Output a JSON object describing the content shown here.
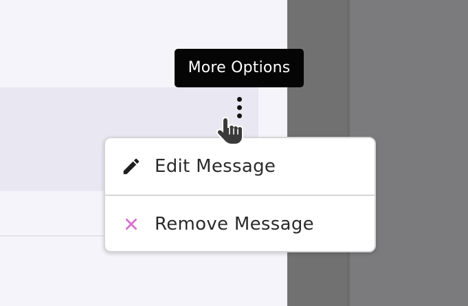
{
  "tooltip": {
    "text": "More Options"
  },
  "menu": {
    "items": [
      {
        "label": "Edit Message",
        "icon": "pencil-icon"
      },
      {
        "label": "Remove Message",
        "icon": "close-icon"
      }
    ]
  },
  "colors": {
    "remove_icon": "#d86fd0",
    "tooltip_bg": "#050505",
    "overlay": "#7b7b7d"
  }
}
